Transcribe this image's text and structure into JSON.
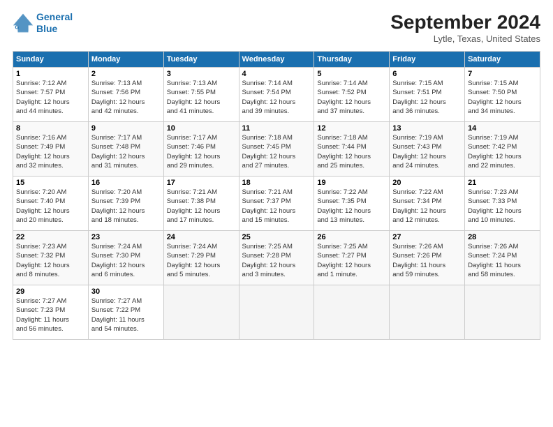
{
  "header": {
    "logo_line1": "General",
    "logo_line2": "Blue",
    "month": "September 2024",
    "location": "Lytle, Texas, United States"
  },
  "weekdays": [
    "Sunday",
    "Monday",
    "Tuesday",
    "Wednesday",
    "Thursday",
    "Friday",
    "Saturday"
  ],
  "weeks": [
    [
      {
        "day": "1",
        "info": "Sunrise: 7:12 AM\nSunset: 7:57 PM\nDaylight: 12 hours\nand 44 minutes."
      },
      {
        "day": "2",
        "info": "Sunrise: 7:13 AM\nSunset: 7:56 PM\nDaylight: 12 hours\nand 42 minutes."
      },
      {
        "day": "3",
        "info": "Sunrise: 7:13 AM\nSunset: 7:55 PM\nDaylight: 12 hours\nand 41 minutes."
      },
      {
        "day": "4",
        "info": "Sunrise: 7:14 AM\nSunset: 7:54 PM\nDaylight: 12 hours\nand 39 minutes."
      },
      {
        "day": "5",
        "info": "Sunrise: 7:14 AM\nSunset: 7:52 PM\nDaylight: 12 hours\nand 37 minutes."
      },
      {
        "day": "6",
        "info": "Sunrise: 7:15 AM\nSunset: 7:51 PM\nDaylight: 12 hours\nand 36 minutes."
      },
      {
        "day": "7",
        "info": "Sunrise: 7:15 AM\nSunset: 7:50 PM\nDaylight: 12 hours\nand 34 minutes."
      }
    ],
    [
      {
        "day": "8",
        "info": "Sunrise: 7:16 AM\nSunset: 7:49 PM\nDaylight: 12 hours\nand 32 minutes."
      },
      {
        "day": "9",
        "info": "Sunrise: 7:17 AM\nSunset: 7:48 PM\nDaylight: 12 hours\nand 31 minutes."
      },
      {
        "day": "10",
        "info": "Sunrise: 7:17 AM\nSunset: 7:46 PM\nDaylight: 12 hours\nand 29 minutes."
      },
      {
        "day": "11",
        "info": "Sunrise: 7:18 AM\nSunset: 7:45 PM\nDaylight: 12 hours\nand 27 minutes."
      },
      {
        "day": "12",
        "info": "Sunrise: 7:18 AM\nSunset: 7:44 PM\nDaylight: 12 hours\nand 25 minutes."
      },
      {
        "day": "13",
        "info": "Sunrise: 7:19 AM\nSunset: 7:43 PM\nDaylight: 12 hours\nand 24 minutes."
      },
      {
        "day": "14",
        "info": "Sunrise: 7:19 AM\nSunset: 7:42 PM\nDaylight: 12 hours\nand 22 minutes."
      }
    ],
    [
      {
        "day": "15",
        "info": "Sunrise: 7:20 AM\nSunset: 7:40 PM\nDaylight: 12 hours\nand 20 minutes."
      },
      {
        "day": "16",
        "info": "Sunrise: 7:20 AM\nSunset: 7:39 PM\nDaylight: 12 hours\nand 18 minutes."
      },
      {
        "day": "17",
        "info": "Sunrise: 7:21 AM\nSunset: 7:38 PM\nDaylight: 12 hours\nand 17 minutes."
      },
      {
        "day": "18",
        "info": "Sunrise: 7:21 AM\nSunset: 7:37 PM\nDaylight: 12 hours\nand 15 minutes."
      },
      {
        "day": "19",
        "info": "Sunrise: 7:22 AM\nSunset: 7:35 PM\nDaylight: 12 hours\nand 13 minutes."
      },
      {
        "day": "20",
        "info": "Sunrise: 7:22 AM\nSunset: 7:34 PM\nDaylight: 12 hours\nand 12 minutes."
      },
      {
        "day": "21",
        "info": "Sunrise: 7:23 AM\nSunset: 7:33 PM\nDaylight: 12 hours\nand 10 minutes."
      }
    ],
    [
      {
        "day": "22",
        "info": "Sunrise: 7:23 AM\nSunset: 7:32 PM\nDaylight: 12 hours\nand 8 minutes."
      },
      {
        "day": "23",
        "info": "Sunrise: 7:24 AM\nSunset: 7:30 PM\nDaylight: 12 hours\nand 6 minutes."
      },
      {
        "day": "24",
        "info": "Sunrise: 7:24 AM\nSunset: 7:29 PM\nDaylight: 12 hours\nand 5 minutes."
      },
      {
        "day": "25",
        "info": "Sunrise: 7:25 AM\nSunset: 7:28 PM\nDaylight: 12 hours\nand 3 minutes."
      },
      {
        "day": "26",
        "info": "Sunrise: 7:25 AM\nSunset: 7:27 PM\nDaylight: 12 hours\nand 1 minute."
      },
      {
        "day": "27",
        "info": "Sunrise: 7:26 AM\nSunset: 7:26 PM\nDaylight: 11 hours\nand 59 minutes."
      },
      {
        "day": "28",
        "info": "Sunrise: 7:26 AM\nSunset: 7:24 PM\nDaylight: 11 hours\nand 58 minutes."
      }
    ],
    [
      {
        "day": "29",
        "info": "Sunrise: 7:27 AM\nSunset: 7:23 PM\nDaylight: 11 hours\nand 56 minutes."
      },
      {
        "day": "30",
        "info": "Sunrise: 7:27 AM\nSunset: 7:22 PM\nDaylight: 11 hours\nand 54 minutes."
      },
      {
        "day": "",
        "info": ""
      },
      {
        "day": "",
        "info": ""
      },
      {
        "day": "",
        "info": ""
      },
      {
        "day": "",
        "info": ""
      },
      {
        "day": "",
        "info": ""
      }
    ]
  ]
}
